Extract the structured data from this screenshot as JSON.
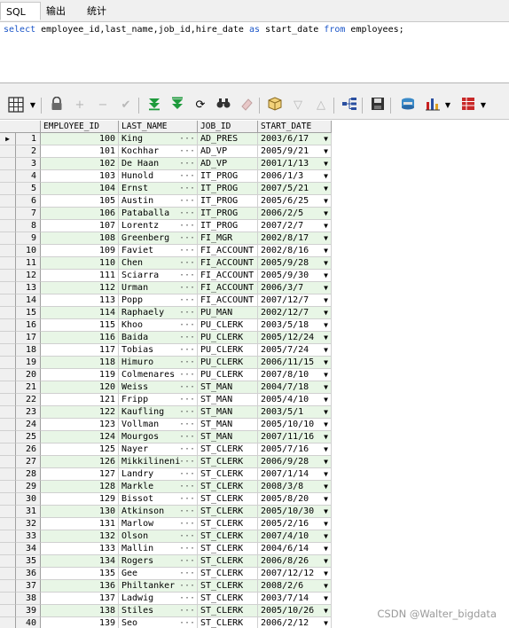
{
  "tabs": [
    {
      "label": "SQL",
      "active": true
    },
    {
      "label": "输出",
      "active": false
    },
    {
      "label": "统计",
      "active": false
    }
  ],
  "editor": {
    "kw_select": "select",
    "columns_text": "employee_id,last_name,job_id,hire_date",
    "kw_as": "as",
    "alias": "start_date",
    "kw_from": "from",
    "table": "employees;"
  },
  "toolbar": {
    "icons": [
      "grid-view-icon",
      "lock-icon",
      "add-icon",
      "remove-icon",
      "post-icon",
      "first-record-icon",
      "last-record-icon",
      "refresh-icon",
      "find-icon",
      "clear-icon",
      "query-by-example-icon",
      "sort-descending-icon",
      "sort-ascending-icon",
      "tree-icon",
      "save-icon",
      "export-icon",
      "chart-icon",
      "table-options-icon"
    ]
  },
  "columns": [
    "EMPLOYEE_ID",
    "LAST_NAME",
    "JOB_ID",
    "START_DATE"
  ],
  "rows": [
    {
      "n": "1",
      "id": "100",
      "last": "King",
      "job": "AD_PRES",
      "date": "2003/6/17"
    },
    {
      "n": "2",
      "id": "101",
      "last": "Kochhar",
      "job": "AD_VP",
      "date": "2005/9/21"
    },
    {
      "n": "3",
      "id": "102",
      "last": "De Haan",
      "job": "AD_VP",
      "date": "2001/1/13"
    },
    {
      "n": "4",
      "id": "103",
      "last": "Hunold",
      "job": "IT_PROG",
      "date": "2006/1/3"
    },
    {
      "n": "5",
      "id": "104",
      "last": "Ernst",
      "job": "IT_PROG",
      "date": "2007/5/21"
    },
    {
      "n": "6",
      "id": "105",
      "last": "Austin",
      "job": "IT_PROG",
      "date": "2005/6/25"
    },
    {
      "n": "7",
      "id": "106",
      "last": "Pataballa",
      "job": "IT_PROG",
      "date": "2006/2/5"
    },
    {
      "n": "8",
      "id": "107",
      "last": "Lorentz",
      "job": "IT_PROG",
      "date": "2007/2/7"
    },
    {
      "n": "9",
      "id": "108",
      "last": "Greenberg",
      "job": "FI_MGR",
      "date": "2002/8/17"
    },
    {
      "n": "10",
      "id": "109",
      "last": "Faviet",
      "job": "FI_ACCOUNT",
      "date": "2002/8/16"
    },
    {
      "n": "11",
      "id": "110",
      "last": "Chen",
      "job": "FI_ACCOUNT",
      "date": "2005/9/28"
    },
    {
      "n": "12",
      "id": "111",
      "last": "Sciarra",
      "job": "FI_ACCOUNT",
      "date": "2005/9/30"
    },
    {
      "n": "13",
      "id": "112",
      "last": "Urman",
      "job": "FI_ACCOUNT",
      "date": "2006/3/7"
    },
    {
      "n": "14",
      "id": "113",
      "last": "Popp",
      "job": "FI_ACCOUNT",
      "date": "2007/12/7"
    },
    {
      "n": "15",
      "id": "114",
      "last": "Raphaely",
      "job": "PU_MAN",
      "date": "2002/12/7"
    },
    {
      "n": "16",
      "id": "115",
      "last": "Khoo",
      "job": "PU_CLERK",
      "date": "2003/5/18"
    },
    {
      "n": "17",
      "id": "116",
      "last": "Baida",
      "job": "PU_CLERK",
      "date": "2005/12/24"
    },
    {
      "n": "18",
      "id": "117",
      "last": "Tobias",
      "job": "PU_CLERK",
      "date": "2005/7/24"
    },
    {
      "n": "19",
      "id": "118",
      "last": "Himuro",
      "job": "PU_CLERK",
      "date": "2006/11/15"
    },
    {
      "n": "20",
      "id": "119",
      "last": "Colmenares",
      "job": "PU_CLERK",
      "date": "2007/8/10"
    },
    {
      "n": "21",
      "id": "120",
      "last": "Weiss",
      "job": "ST_MAN",
      "date": "2004/7/18"
    },
    {
      "n": "22",
      "id": "121",
      "last": "Fripp",
      "job": "ST_MAN",
      "date": "2005/4/10"
    },
    {
      "n": "23",
      "id": "122",
      "last": "Kaufling",
      "job": "ST_MAN",
      "date": "2003/5/1"
    },
    {
      "n": "24",
      "id": "123",
      "last": "Vollman",
      "job": "ST_MAN",
      "date": "2005/10/10"
    },
    {
      "n": "25",
      "id": "124",
      "last": "Mourgos",
      "job": "ST_MAN",
      "date": "2007/11/16"
    },
    {
      "n": "26",
      "id": "125",
      "last": "Nayer",
      "job": "ST_CLERK",
      "date": "2005/7/16"
    },
    {
      "n": "27",
      "id": "126",
      "last": "Mikkilineni",
      "job": "ST_CLERK",
      "date": "2006/9/28"
    },
    {
      "n": "28",
      "id": "127",
      "last": "Landry",
      "job": "ST_CLERK",
      "date": "2007/1/14"
    },
    {
      "n": "29",
      "id": "128",
      "last": "Markle",
      "job": "ST_CLERK",
      "date": "2008/3/8"
    },
    {
      "n": "30",
      "id": "129",
      "last": "Bissot",
      "job": "ST_CLERK",
      "date": "2005/8/20"
    },
    {
      "n": "31",
      "id": "130",
      "last": "Atkinson",
      "job": "ST_CLERK",
      "date": "2005/10/30"
    },
    {
      "n": "32",
      "id": "131",
      "last": "Marlow",
      "job": "ST_CLERK",
      "date": "2005/2/16"
    },
    {
      "n": "33",
      "id": "132",
      "last": "Olson",
      "job": "ST_CLERK",
      "date": "2007/4/10"
    },
    {
      "n": "34",
      "id": "133",
      "last": "Mallin",
      "job": "ST_CLERK",
      "date": "2004/6/14"
    },
    {
      "n": "35",
      "id": "134",
      "last": "Rogers",
      "job": "ST_CLERK",
      "date": "2006/8/26"
    },
    {
      "n": "36",
      "id": "135",
      "last": "Gee",
      "job": "ST_CLERK",
      "date": "2007/12/12"
    },
    {
      "n": "37",
      "id": "136",
      "last": "Philtanker",
      "job": "ST_CLERK",
      "date": "2008/2/6"
    },
    {
      "n": "38",
      "id": "137",
      "last": "Ladwig",
      "job": "ST_CLERK",
      "date": "2003/7/14"
    },
    {
      "n": "39",
      "id": "138",
      "last": "Stiles",
      "job": "ST_CLERK",
      "date": "2005/10/26"
    },
    {
      "n": "40",
      "id": "139",
      "last": "Seo",
      "job": "ST_CLERK",
      "date": "2006/2/12"
    }
  ],
  "cell_dots": "···",
  "watermark": "CSDN @Walter_bigdata",
  "colors": {
    "row_alt": "#e8f6e6",
    "keyword": "#1a55c8",
    "toolbar_bg": "#f0f0f0"
  }
}
